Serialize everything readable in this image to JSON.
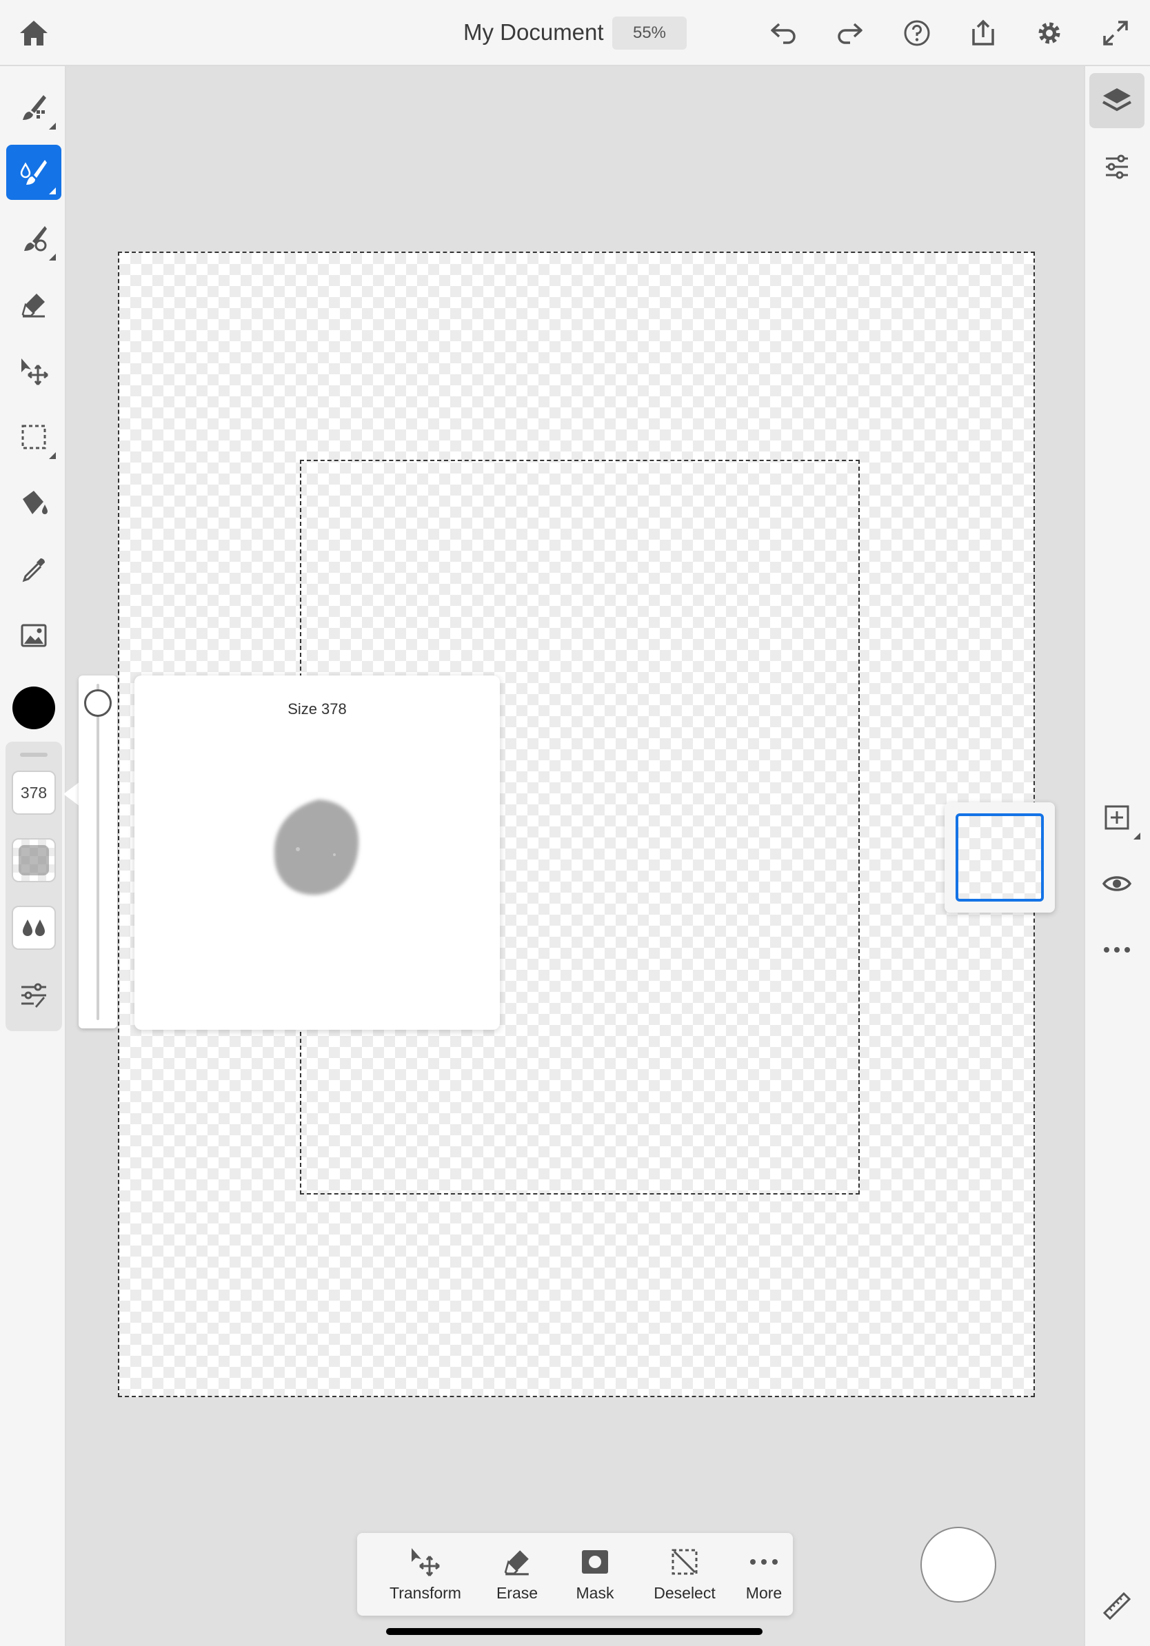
{
  "header": {
    "document_title": "My Document",
    "zoom_level": "55%",
    "icons": [
      "home-icon",
      "undo-icon",
      "redo-icon",
      "help-icon",
      "share-icon",
      "gear-icon",
      "fullscreen-icon"
    ]
  },
  "left_toolbar": {
    "tools": [
      "brush-tool-icon",
      "watercolor-brush-icon",
      "pixel-brush-icon",
      "eraser-icon",
      "move-icon",
      "marquee-select-icon",
      "paint-bucket-icon",
      "eyedropper-icon",
      "image-icon"
    ],
    "active_tool": "watercolor-brush-icon",
    "current_color": "#000000",
    "brush_settings": {
      "size_value": "378",
      "icons": [
        "opacity-icon",
        "flow-icon",
        "brush-settings-icon"
      ]
    }
  },
  "brush_popover": {
    "label": "Size",
    "value": "378"
  },
  "right_panel": {
    "icons": [
      "layers-icon",
      "adjustments-icon",
      "add-layer-icon",
      "visibility-icon",
      "more-icon",
      "ruler-icon"
    ]
  },
  "action_bar": {
    "actions": [
      {
        "label": "Transform",
        "icon": "transform-icon"
      },
      {
        "label": "Erase",
        "icon": "eraser-icon"
      },
      {
        "label": "Mask",
        "icon": "mask-icon"
      },
      {
        "label": "Deselect",
        "icon": "deselect-icon"
      },
      {
        "label": "More",
        "icon": "more-icon"
      }
    ]
  },
  "colors": {
    "accent": "#1473e6",
    "toolbar_bg": "#f5f5f5",
    "workspace_bg": "#e0e0e0"
  }
}
